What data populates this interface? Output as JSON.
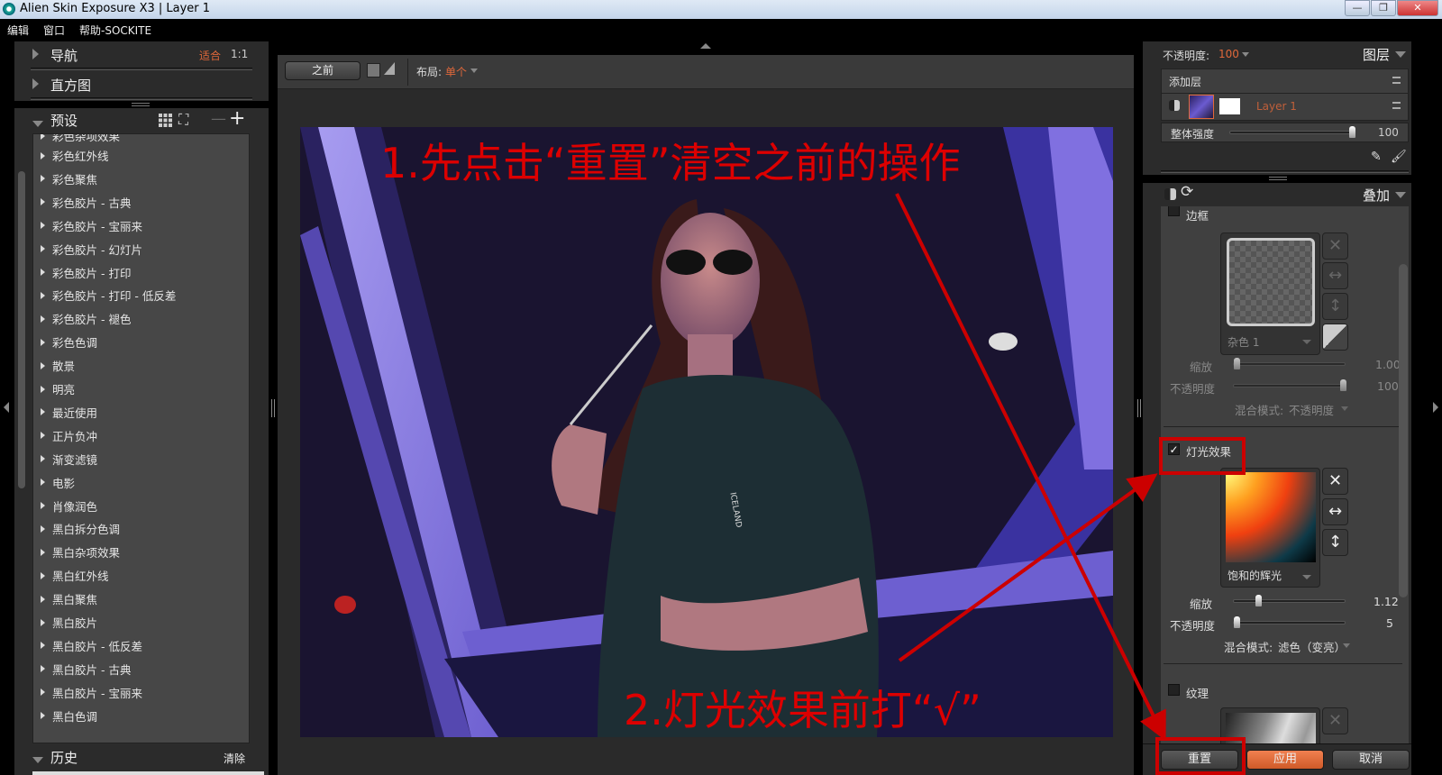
{
  "window": {
    "title": "Alien Skin Exposure X3 | Layer 1",
    "minimize": "—",
    "restore": "❐",
    "close": "✕"
  },
  "menu": [
    "编辑",
    "窗口",
    "帮助-SOCKITE"
  ],
  "left": {
    "navigator": {
      "label": "导航",
      "fit": "适合",
      "one_to_one": "1:1"
    },
    "histogram": {
      "label": "直方图"
    },
    "presets": {
      "label": "预设",
      "minus": "—",
      "plus": "+",
      "partial_item": "彩色杂项效果",
      "items": [
        "彩色红外线",
        "彩色聚焦",
        "彩色胶片 - 古典",
        "彩色胶片 - 宝丽来",
        "彩色胶片 - 幻灯片",
        "彩色胶片 - 打印",
        "彩色胶片 - 打印 - 低反差",
        "彩色胶片 - 褪色",
        "彩色色调",
        "散景",
        "明亮",
        "最近使用",
        "正片负冲",
        "渐变滤镜",
        "电影",
        "肖像润色",
        "黑白拆分色调",
        "黑白杂项效果",
        "黑白红外线",
        "黑白聚焦",
        "黑白胶片",
        "黑白胶片 - 低反差",
        "黑白胶片 - 古典",
        "黑白胶片 - 宝丽来",
        "黑白色调"
      ]
    },
    "history": {
      "label": "历史",
      "clear": "清除"
    }
  },
  "toolbar": {
    "before": "之前",
    "layout_label": "布局:",
    "layout_value": "单个"
  },
  "photo": {
    "logo_text": "ICELAND"
  },
  "annotations": {
    "step1": "1.先点击“重置”清空之前的操作",
    "step2": "2.灯光效果前打“√”"
  },
  "layers": {
    "opacity_label": "不透明度:",
    "opacity_value": "100",
    "title": "图层",
    "add_layer": "添加层",
    "layer_name": "Layer 1",
    "strength_label": "整体强度",
    "strength_value": "100",
    "strength_fraction": 1.0
  },
  "overlay": {
    "title": "叠加",
    "border": {
      "label": "边框",
      "checked": false,
      "preset": "杂色 1",
      "scale_label": "缩放",
      "scale_value": "1.00",
      "scale_fraction": 0.0,
      "opacity_label": "不透明度",
      "opacity_value": "100",
      "opacity_fraction": 1.0,
      "blend_label": "混合模式:",
      "blend_value": "不透明度"
    },
    "light": {
      "label": "灯光效果",
      "checked": true,
      "check_mark": "✓",
      "preset": "饱和的辉光",
      "scale_label": "缩放",
      "scale_value": "1.12",
      "scale_fraction": 0.2,
      "opacity_label": "不透明度",
      "opacity_value": "5",
      "opacity_fraction": 0.0,
      "blend_label": "混合模式:",
      "blend_value": "滤色（变亮）"
    },
    "texture": {
      "label": "纹理",
      "checked": false
    }
  },
  "buttons": {
    "reset": "重置",
    "apply": "应用",
    "cancel": "取消"
  },
  "colors": {
    "accent": "#e0683a",
    "annotation": "#cc0000"
  }
}
